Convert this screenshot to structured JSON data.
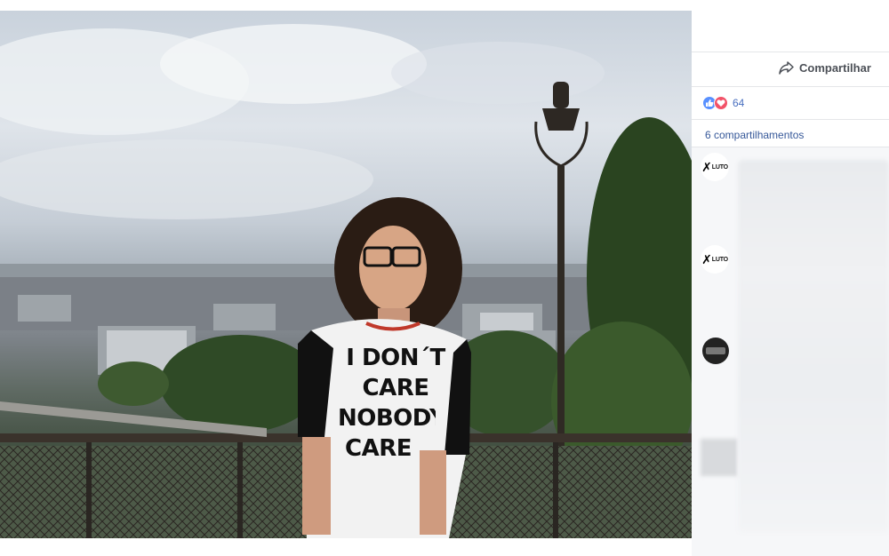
{
  "photo": {
    "shirt_text_lines": [
      "I DON´T",
      "CARE",
      "NOBODY",
      "CARE"
    ]
  },
  "panel": {
    "share_label": "Compartilhar",
    "share_icon": "share-arrow-icon",
    "reactions": {
      "types": [
        "like",
        "love"
      ],
      "count": "64"
    },
    "shares_label": "6 compartilhamentos",
    "comments": [
      {
        "avatar_text": "LUTO",
        "avatar_icon": "black-ribbon-icon"
      },
      {
        "avatar_text": "LUTO",
        "avatar_icon": "black-ribbon-icon"
      },
      {
        "avatar_text": "",
        "avatar_icon": "profile-photo-icon"
      }
    ]
  },
  "colors": {
    "link_blue": "#365899",
    "like_blue": "#5890ff",
    "love_red": "#f25268"
  }
}
